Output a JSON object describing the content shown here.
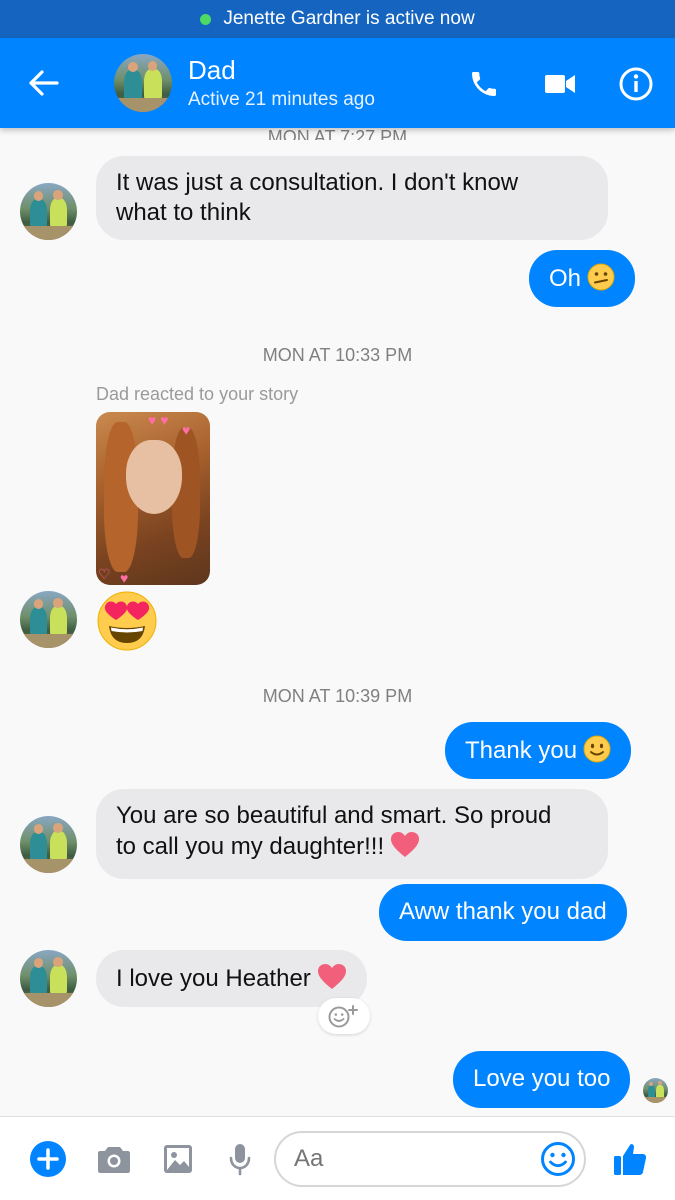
{
  "status_bar": {
    "active_text": "Jenette Gardner is active now"
  },
  "header": {
    "contact_name": "Dad",
    "contact_status": "Active 21 minutes ago"
  },
  "conversation": {
    "timestamp_partial": "MON AT 7:27 PM",
    "msg1": "It was just a consultation. I don't know",
    "msg1_line2": "what to think",
    "msg2": "Oh",
    "timestamp2": "MON AT 10:33 PM",
    "story_label": "Dad reacted to your story",
    "timestamp3": "MON AT 10:39 PM",
    "msg3": "Thank you",
    "msg4_line1": "You are so beautiful and smart. So proud",
    "msg4_line2": "to call you my daughter!!!",
    "msg5": "Aww thank you dad",
    "msg6": "I love you Heather",
    "msg7": "Love you too"
  },
  "composer": {
    "placeholder": "Aa"
  },
  "colors": {
    "messenger_blue": "#0084ff",
    "status_bar": "#1565c0",
    "incoming_bubble": "#e9e9eb",
    "active_dot": "#4cd964"
  },
  "icons": [
    "back-arrow-icon",
    "phone-icon",
    "video-camera-icon",
    "info-icon",
    "plus-icon",
    "camera-icon",
    "image-icon",
    "mic-icon",
    "emoji-icon",
    "thumbs-up-icon",
    "heart-eyes-emoji",
    "confused-emoji",
    "smile-emoji",
    "heart-emoji",
    "add-reaction-icon"
  ]
}
